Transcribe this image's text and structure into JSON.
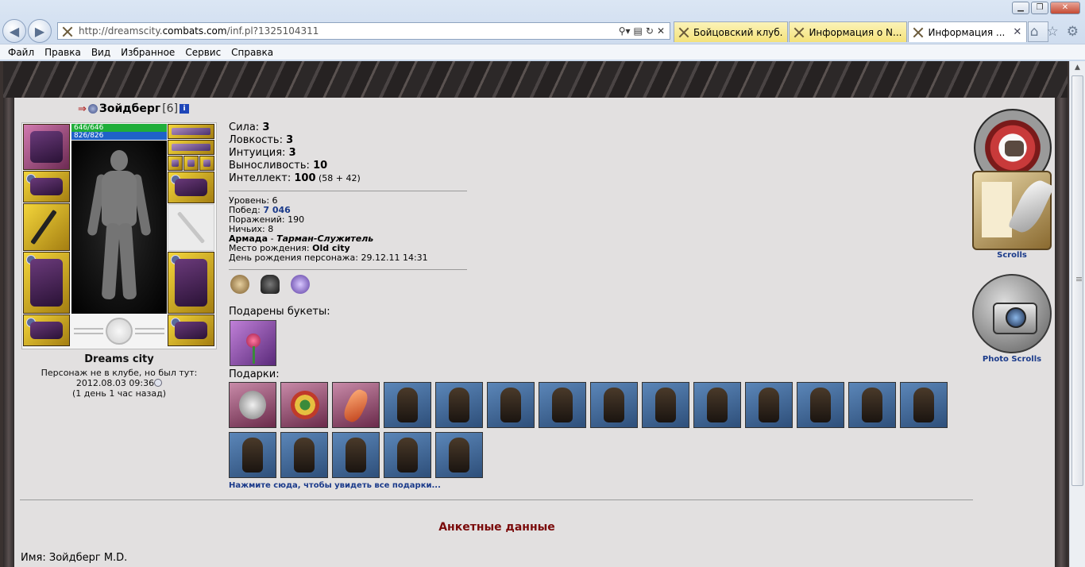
{
  "browser": {
    "url_prefix": "http://dreamscity.",
    "url_domain": "combats.com",
    "url_path": "/inf.pl?1325104311",
    "tabs": [
      {
        "label": "Бойцовский клуб."
      },
      {
        "label": "Информация о N..."
      },
      {
        "label": "Информация ..."
      }
    ],
    "menu": [
      "Файл",
      "Правка",
      "Вид",
      "Избранное",
      "Сервис",
      "Справка"
    ]
  },
  "character": {
    "name": "Зойдберг",
    "level": "[6]",
    "hp": "646/646",
    "mana": "826/826",
    "city": "Dreams city",
    "status_line": "Персонаж не в клубе, но был тут:",
    "last_seen": "2012.08.03 09:36",
    "ago": "(1 день 1 час назад)"
  },
  "stats": [
    {
      "label": "Сила: ",
      "value": "3",
      "extra": ""
    },
    {
      "label": "Ловкость: ",
      "value": "3",
      "extra": ""
    },
    {
      "label": "Интуиция: ",
      "value": "3",
      "extra": ""
    },
    {
      "label": "Выносливость: ",
      "value": "10",
      "extra": ""
    },
    {
      "label": "Интеллект: ",
      "value": "100",
      "extra": " (58 + 42)"
    }
  ],
  "info": {
    "level_label": "Уровень: ",
    "level_value": "6",
    "wins_label": "Побед: ",
    "wins_value": "7 046",
    "losses_label": "Поражений: ",
    "losses_value": "190",
    "draws_label": "Ничьих: ",
    "draws_value": "8",
    "clan_name": "Армада",
    "clan_sep": " - ",
    "clan_rank": "Тарман-Служитель",
    "birthplace_label": "Место рождения: ",
    "birthplace_value": "Old city",
    "birthday_label": "День рождения персонажа: ",
    "birthday_value": "29.12.11 14:31"
  },
  "bouquets_label": "Подарены букеты:",
  "gifts_label": "Подарки:",
  "gifts": [
    "shield",
    "target",
    "crystal",
    "monk",
    "monk",
    "monk",
    "monk",
    "monk",
    "monk",
    "monk",
    "monk",
    "monk",
    "monk",
    "monk",
    "monk",
    "monk",
    "monk",
    "monk",
    "monk"
  ],
  "all_gifts_link": "Нажмите сюда, чтобы увидеть все подарки...",
  "anket_title": "Анкетные данные",
  "name_row": "Имя: Зойдберг M.D.",
  "sidebar": {
    "scrolls_label": "Scrolls",
    "photo_label": "Photo Scrolls"
  },
  "colors": {
    "link_blue": "#1a3a8a",
    "anket_red": "#7a0a0a",
    "hp_green": "#1fae3a",
    "mana_blue": "#1f62c8"
  }
}
